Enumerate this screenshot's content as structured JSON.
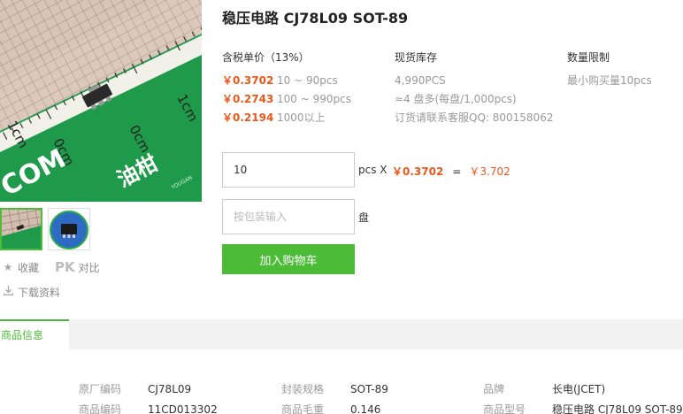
{
  "product": {
    "title": "稳压电路 CJ78L09 SOT-89"
  },
  "image": {
    "main_alt": "CJ78L09 SOT-89 chip on ruler mat",
    "ruler_text_1": "1cm",
    "ruler_text_2": "0cm",
    "ruler_text_3": "0cm",
    "ruler_text_4": "1cm",
    "brand_text": "COM",
    "brand_cn": "油柑",
    "watermark": "YOUGAN"
  },
  "thumbs": [
    {
      "name": "thumb-1",
      "active": true
    },
    {
      "name": "thumb-2",
      "active": false
    }
  ],
  "actions": {
    "favorite": "收藏",
    "pk": "PK",
    "compare": "对比",
    "download": "下载资料"
  },
  "pricing": {
    "header": "含税单价（13%）",
    "tiers": [
      {
        "price": "￥0.3702",
        "range": "10 ~ 90pcs"
      },
      {
        "price": "￥0.2743",
        "range": "100 ~ 990pcs"
      },
      {
        "price": "￥0.2194",
        "range": "1000以上"
      }
    ]
  },
  "stock": {
    "header": "现货库存",
    "quantity": "4,990PCS",
    "reels": "≈4 盘多(每盘/1,000pcs)",
    "contact": "订货请联系客服QQ: 800158062"
  },
  "limit": {
    "header": "数量限制",
    "text": "最小购买量10pcs"
  },
  "order": {
    "qty_value": "10",
    "qty_unit": "pcs X",
    "unit_price": "￥0.3702",
    "equals": "=",
    "total": "￥3.702",
    "pack_placeholder": "按包装输入",
    "pack_unit": "盘",
    "add_to_cart": "加入购物车"
  },
  "tabs": {
    "active": "商品信息"
  },
  "info": {
    "col1": [
      {
        "key": "原厂编码",
        "value": "CJ78L09"
      },
      {
        "key": "商品编码",
        "value": "11CD013302"
      }
    ],
    "col2": [
      {
        "key": "封装规格",
        "value": "SOT-89"
      },
      {
        "key": "商品毛重",
        "value": "0.146"
      }
    ],
    "col3": [
      {
        "key": "品牌",
        "value": "长电(JCET)"
      },
      {
        "key": "商品型号",
        "value": "稳压电路 CJ78L09 SOT-89"
      }
    ]
  },
  "colors": {
    "accent_green": "#4cbb38",
    "price_orange": "#e8581b"
  }
}
